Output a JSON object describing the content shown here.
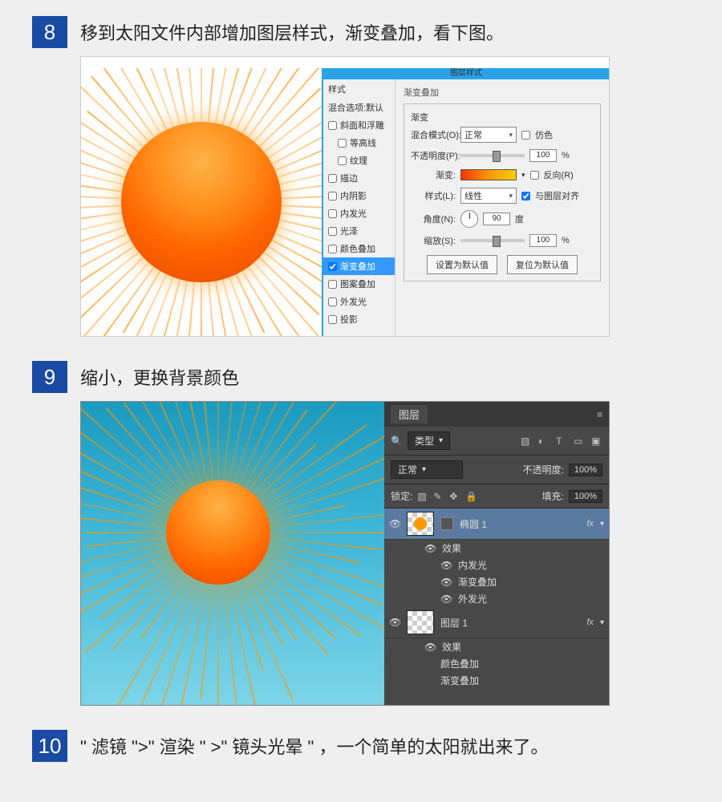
{
  "steps": {
    "s8": {
      "num": "8",
      "text": "移到太阳文件内部增加图层样式，渐变叠加，看下图。"
    },
    "s9": {
      "num": "9",
      "text": "缩小，更换背景颜色"
    },
    "s10": {
      "num": "10",
      "text": "\" 滤镜 \">\" 渲染 \" >\" 镜头光晕 \" ，一个简单的太阳就出来了。"
    }
  },
  "dialog": {
    "title": "图层样式",
    "styles_header": "样式",
    "blend_default": "混合选项:默认",
    "items": {
      "bevel": "斜面和浮雕",
      "contour": "等高线",
      "texture": "纹理",
      "stroke": "描边",
      "innerShadow": "内阴影",
      "innerGlow": "内发光",
      "satin": "光泽",
      "colorOverlay": "颜色叠加",
      "gradientOverlay": "渐变叠加",
      "patternOverlay": "图案叠加",
      "outerGlow": "外发光",
      "dropShadow": "投影"
    },
    "section": "渐变叠加",
    "group": "渐变",
    "blendMode": {
      "label": "混合模式(O):",
      "value": "正常"
    },
    "dither": "仿色",
    "opacity": {
      "label": "不透明度(P):",
      "value": "100",
      "unit": "%"
    },
    "gradient": {
      "label": "渐变:"
    },
    "reverse": "反向(R)",
    "style": {
      "label": "样式(L):",
      "value": "线性"
    },
    "alignLayer": "与图层对齐",
    "angle": {
      "label": "角度(N):",
      "value": "90",
      "unit": "度"
    },
    "scale": {
      "label": "缩放(S):",
      "value": "100",
      "unit": "%"
    },
    "btnDefault": "设置为默认值",
    "btnReset": "复位为默认值"
  },
  "layersPanel": {
    "tab": "图层",
    "filterKind": "类型",
    "mode": "正常",
    "opacityLabel": "不透明度:",
    "opacityVal": "100%",
    "lockLabel": "锁定:",
    "fillLabel": "填充:",
    "fillVal": "100%",
    "layer1": "椭圆 1",
    "layer2": "图层 1",
    "fxLabel": "效果",
    "fxSym": "fx",
    "fx": {
      "innerGlow": "内发光",
      "gradientOverlay": "渐变叠加",
      "outerGlow": "外发光",
      "colorOverlay": "颜色叠加"
    }
  }
}
